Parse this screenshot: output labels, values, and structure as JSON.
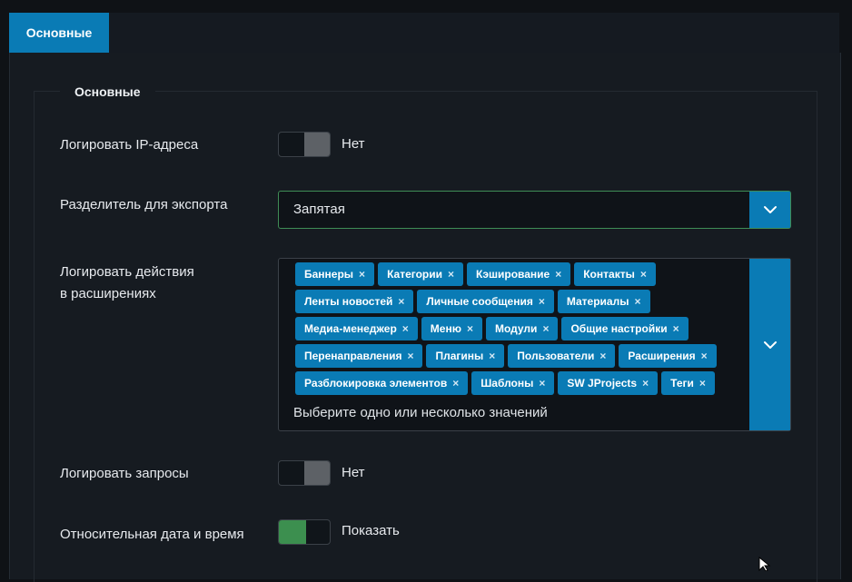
{
  "tabs": [
    {
      "label": "Основные",
      "active": true
    }
  ],
  "fieldset": {
    "legend": "Основные"
  },
  "fields": {
    "log_ip": {
      "label": "Логировать IP-адреса",
      "state_text": "Нет",
      "checked": false
    },
    "separator": {
      "label": "Разделитель для экспорта",
      "value": "Запятая"
    },
    "log_extensions": {
      "label_line1": "Логировать действия",
      "label_line2": "в расширениях",
      "tags": [
        "Баннеры",
        "Категории",
        "Кэширование",
        "Контакты",
        "Ленты новостей",
        "Личные сообщения",
        "Материалы",
        "Медиа-менеджер",
        "Меню",
        "Модули",
        "Общие настройки",
        "Перенаправления",
        "Плагины",
        "Пользователи",
        "Расширения",
        "Разблокировка элементов",
        "Шаблоны",
        "SW JProjects",
        "Теги"
      ],
      "remove_symbol": "×",
      "placeholder": "Выберите одно или несколько значений"
    },
    "log_queries": {
      "label": "Логировать запросы",
      "state_text": "Нет",
      "checked": false
    },
    "relative_date": {
      "label": "Относительная дата и время",
      "state_text": "Показать",
      "checked": true
    }
  },
  "colors": {
    "accent": "#0a7bb5",
    "success": "#3c8f4f",
    "background": "#0f1216"
  },
  "icons": {
    "dropdown": "chevron-down-icon",
    "cursor": "mouse-pointer-icon"
  }
}
